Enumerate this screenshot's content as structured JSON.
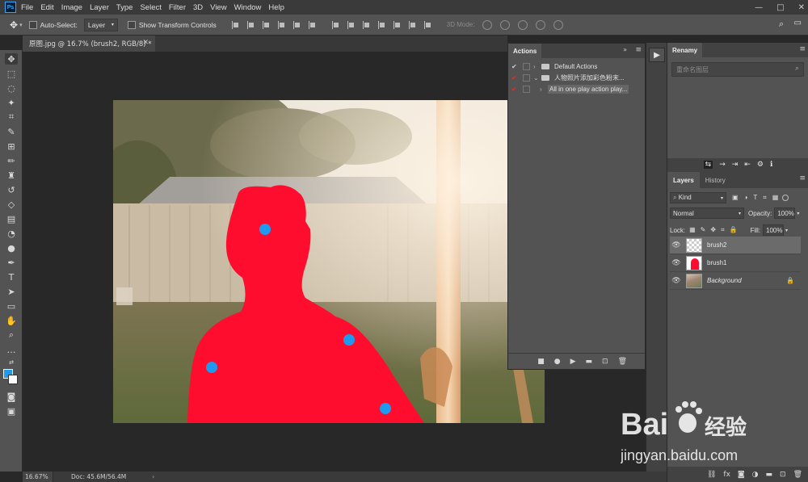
{
  "app": {
    "logo": "Ps"
  },
  "menu": [
    "File",
    "Edit",
    "Image",
    "Layer",
    "Type",
    "Select",
    "Filter",
    "3D",
    "View",
    "Window",
    "Help"
  ],
  "window_controls": [
    "—",
    "□",
    "✕"
  ],
  "options_bar": {
    "auto_select_label": "Auto-Select:",
    "auto_select_target": "Layer",
    "show_transform_label": "Show Transform Controls",
    "mode_3d_label": "3D Mode:"
  },
  "document": {
    "tab_title": "原图.jpg @ 16.7% (brush2, RGB/8) *",
    "zoom": "16.67%",
    "doc_size": "Doc: 45.6M/56.4M"
  },
  "colors": {
    "foreground": "#1e9af0",
    "background": "#ffffff",
    "mask": "#ff0d2f",
    "dots": "#1e9af0"
  },
  "actions_panel": {
    "title": "Actions",
    "rows": [
      {
        "label": "Default Actions",
        "type": "set",
        "expanded": false,
        "checked": true
      },
      {
        "label": "人物照片添加彩色粉末...",
        "type": "set",
        "expanded": true,
        "checked": true
      },
      {
        "label": "All in one play action play...",
        "type": "action",
        "expanded": false,
        "checked": true
      }
    ],
    "footer_icons": [
      "stop-icon",
      "record-icon",
      "play-icon",
      "folder-icon",
      "new-icon",
      "trash-icon"
    ]
  },
  "renamy_panel": {
    "title": "Renamy",
    "search_placeholder": "重命名图层"
  },
  "layers_panel": {
    "tabs": [
      "Layers",
      "History"
    ],
    "filter_label": "Kind",
    "blend_mode": "Normal",
    "opacity_label": "Opacity:",
    "opacity_value": "100%",
    "lock_label": "Lock:",
    "fill_label": "Fill:",
    "fill_value": "100%",
    "layers": [
      {
        "name": "brush2",
        "thumb": "transparent",
        "selected": true,
        "locked": false
      },
      {
        "name": "brush1",
        "thumb": "red-silhouette",
        "selected": false,
        "locked": false
      },
      {
        "name": "Background",
        "thumb": "photo",
        "selected": false,
        "locked": true
      }
    ]
  },
  "watermark": {
    "brand": "Bai",
    "brand_cn": "经验",
    "url": "jingyan.baidu.com"
  }
}
